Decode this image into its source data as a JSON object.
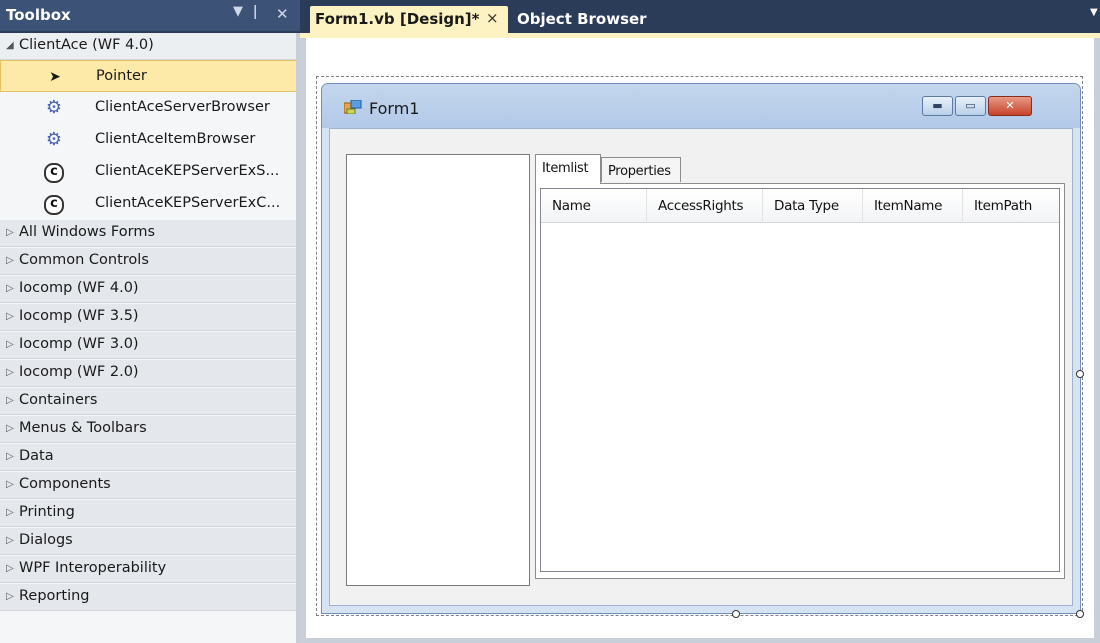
{
  "toolbox": {
    "title": "Toolbox",
    "dropdown_icon": "dropdown-arrow",
    "pin_icon": "pin",
    "close_icon": "close",
    "expanded_group": {
      "label": "ClientAce (WF 4.0)",
      "items": [
        {
          "label": "Pointer",
          "icon": "pointer-arrow",
          "selected": true
        },
        {
          "label": "ClientAceServerBrowser",
          "icon": "gear"
        },
        {
          "label": "ClientAceItemBrowser",
          "icon": "gear"
        },
        {
          "label": "ClientAceKEPServerExS...",
          "icon": "clientace-logo"
        },
        {
          "label": "ClientAceKEPServerExC...",
          "icon": "clientace-logo"
        }
      ]
    },
    "groups": [
      "All Windows Forms",
      "Common Controls",
      "Iocomp (WF 4.0)",
      "Iocomp (WF 3.5)",
      "Iocomp (WF 3.0)",
      "Iocomp (WF 2.0)",
      "Containers",
      "Menus & Toolbars",
      "Data",
      "Components",
      "Printing",
      "Dialogs",
      "WPF Interoperability",
      "Reporting"
    ]
  },
  "tabs": {
    "design": {
      "label": "Form1.vb [Design]*",
      "close": "×"
    },
    "object_browser": {
      "label": "Object Browser"
    }
  },
  "form": {
    "title": "Form1",
    "tab_control": {
      "tabs": [
        "Itemlist",
        "Properties"
      ],
      "active": "Itemlist",
      "columns": [
        "Name",
        "AccessRights",
        "Data Type",
        "ItemName",
        "ItemPath"
      ]
    }
  },
  "colors": {
    "chrome": "#2b3c59",
    "active_tab": "#fdf2c1",
    "selected_tool": "#fde9a8"
  }
}
